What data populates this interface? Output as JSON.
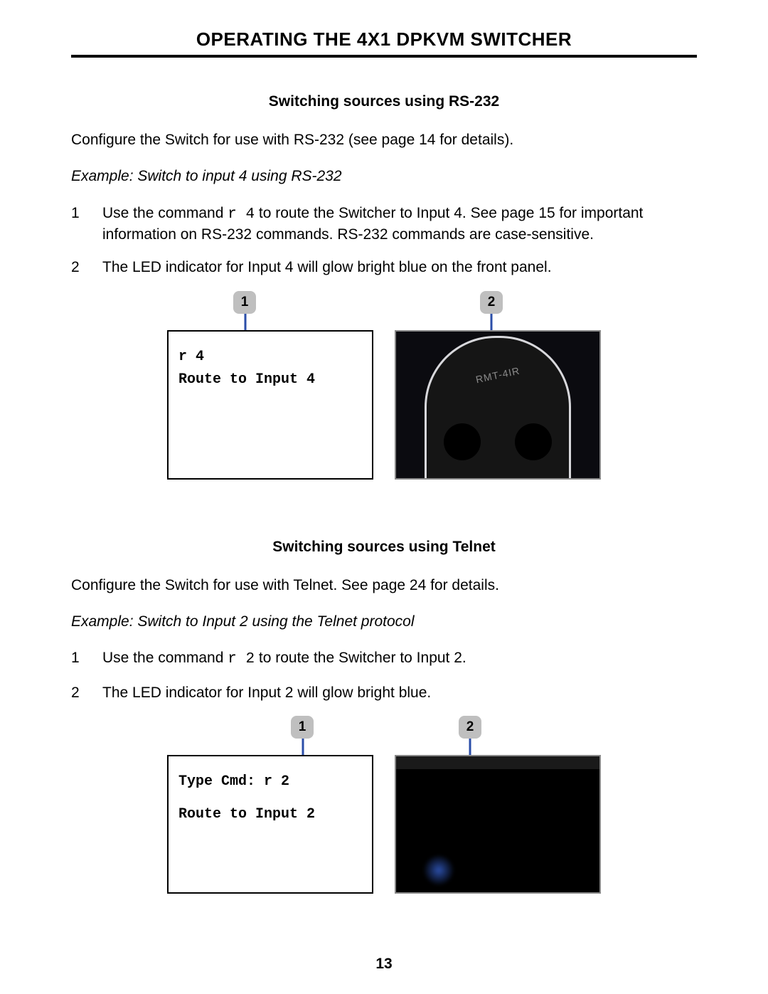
{
  "header": "OPERATING THE 4X1 DPKVM SWITCHER",
  "page_number": "13",
  "rs232": {
    "title": "Switching sources using RS-232",
    "intro": "Configure the Switch for use with RS-232 (see page 14 for details).",
    "example": "Example: Switch to input 4 using RS-232",
    "step1_num": "1",
    "step1_pre": "Use the command ",
    "step1_cmd": "r 4",
    "step1_post": " to route the Switcher to Input 4.  See page 15 for important information on RS-232 commands.  RS-232 commands are case-sensitive.",
    "step2_num": "2",
    "step2_text": "The LED indicator for Input 4 will glow bright blue on the front panel.",
    "badge1": "1",
    "badge2": "2",
    "term_line1": "r 4",
    "term_line2": "Route to Input 4",
    "remote_label": "RMT-4IR"
  },
  "telnet": {
    "title": "Switching sources using Telnet",
    "intro": "Configure the Switch for use with Telnet.  See page 24 for details.",
    "example": "Example: Switch to Input 2 using the Telnet protocol",
    "step1_num": "1",
    "step1_pre": "Use the command ",
    "step1_cmd": "r 2",
    "step1_post": " to route the Switcher to Input 2.",
    "step2_num": "2",
    "step2_text": "The LED indicator for Input 2 will glow bright blue.",
    "badge1": "1",
    "badge2": "2",
    "term_line1": "Type Cmd: r 2",
    "term_line2": "Route to Input 2"
  }
}
